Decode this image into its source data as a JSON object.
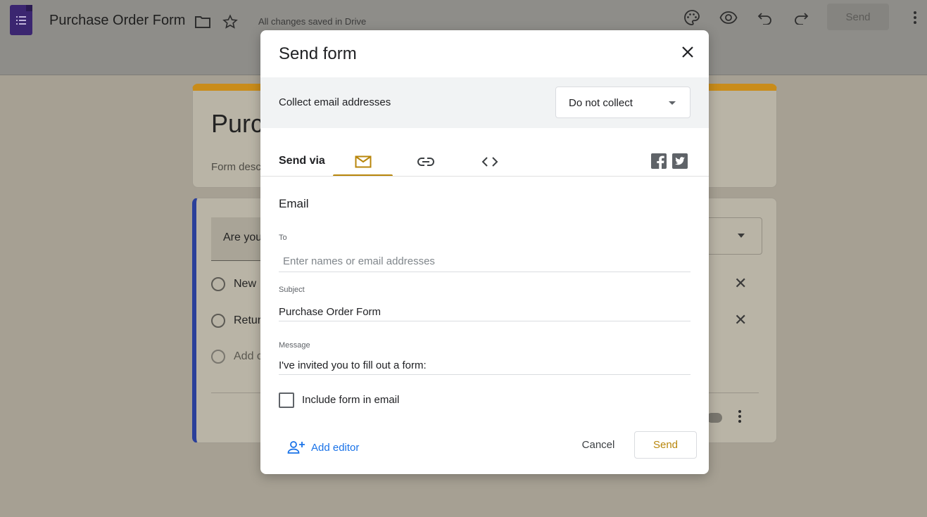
{
  "app": {
    "title": "Purchase Order Form",
    "save_status": "All changes saved in Drive",
    "send_label": "Send",
    "icons": [
      "forms-logo-icon",
      "folder-icon",
      "star-icon",
      "palette-icon",
      "preview-eye-icon",
      "undo-icon",
      "redo-icon",
      "more-vert-icon"
    ]
  },
  "background_form": {
    "title_fragment": "Purc",
    "description_fragment": "Form desc",
    "question_fragment": "Are you",
    "options": [
      "New",
      "Retur",
      "Add c"
    ]
  },
  "dialog": {
    "title": "Send form",
    "collect": {
      "label": "Collect email addresses",
      "selected": "Do not collect"
    },
    "send_via_label": "Send via",
    "tabs": [
      {
        "name": "email",
        "icon": "mail-icon",
        "active": true
      },
      {
        "name": "link",
        "icon": "link-icon",
        "active": false
      },
      {
        "name": "embed",
        "icon": "code-icon",
        "active": false
      }
    ],
    "social": [
      "facebook-icon",
      "twitter-icon"
    ],
    "email": {
      "heading": "Email",
      "to_label": "To",
      "to_placeholder": "Enter names or email addresses",
      "subject_label": "Subject",
      "subject_value": "Purchase Order Form",
      "message_label": "Message",
      "message_value": "I've invited you to fill out a form:",
      "include_label": "Include form in email"
    },
    "add_editor_label": "Add editor",
    "cancel_label": "Cancel",
    "send_label": "Send"
  },
  "colors": {
    "accent": "#b8860b",
    "link": "#1a73e8",
    "overlay": "#a6a093"
  }
}
